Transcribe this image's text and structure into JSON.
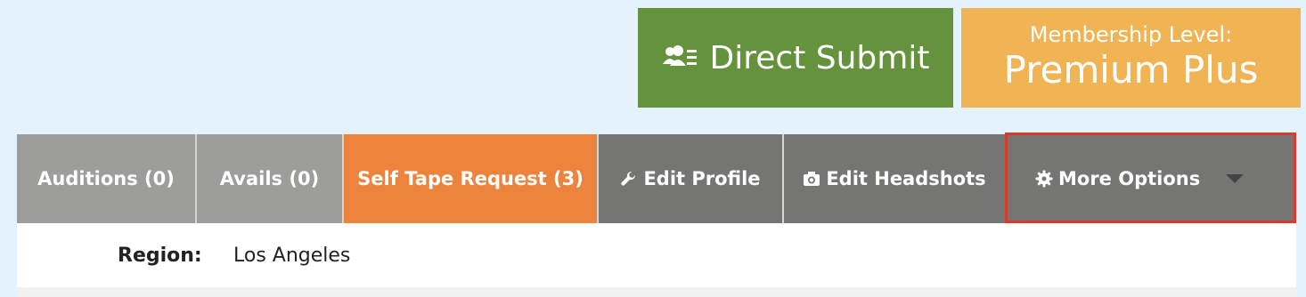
{
  "header": {
    "direct_submit_label": "Direct Submit",
    "direct_submit_icon": "users-list-icon",
    "membership_label": "Membership Level:",
    "membership_level": "Premium Plus"
  },
  "tabs": [
    {
      "label": "Auditions (0)"
    },
    {
      "label": "Avails (0)"
    },
    {
      "label": "Self Tape Request (3)"
    },
    {
      "label": "Edit Profile",
      "icon": "wrench-icon"
    },
    {
      "label": "Edit Headshots",
      "icon": "camera-icon"
    },
    {
      "label": "More Options",
      "icon": "gear-icon"
    }
  ],
  "region": {
    "label": "Region:",
    "value": "Los Angeles"
  },
  "colors": {
    "background": "#e3f2fc",
    "direct_submit": "#65923d",
    "membership": "#f0b455",
    "tab_light": "#9d9d9c",
    "tab_dark": "#757674",
    "tab_active": "#ec843e",
    "highlight_outline": "#d83a2c"
  }
}
